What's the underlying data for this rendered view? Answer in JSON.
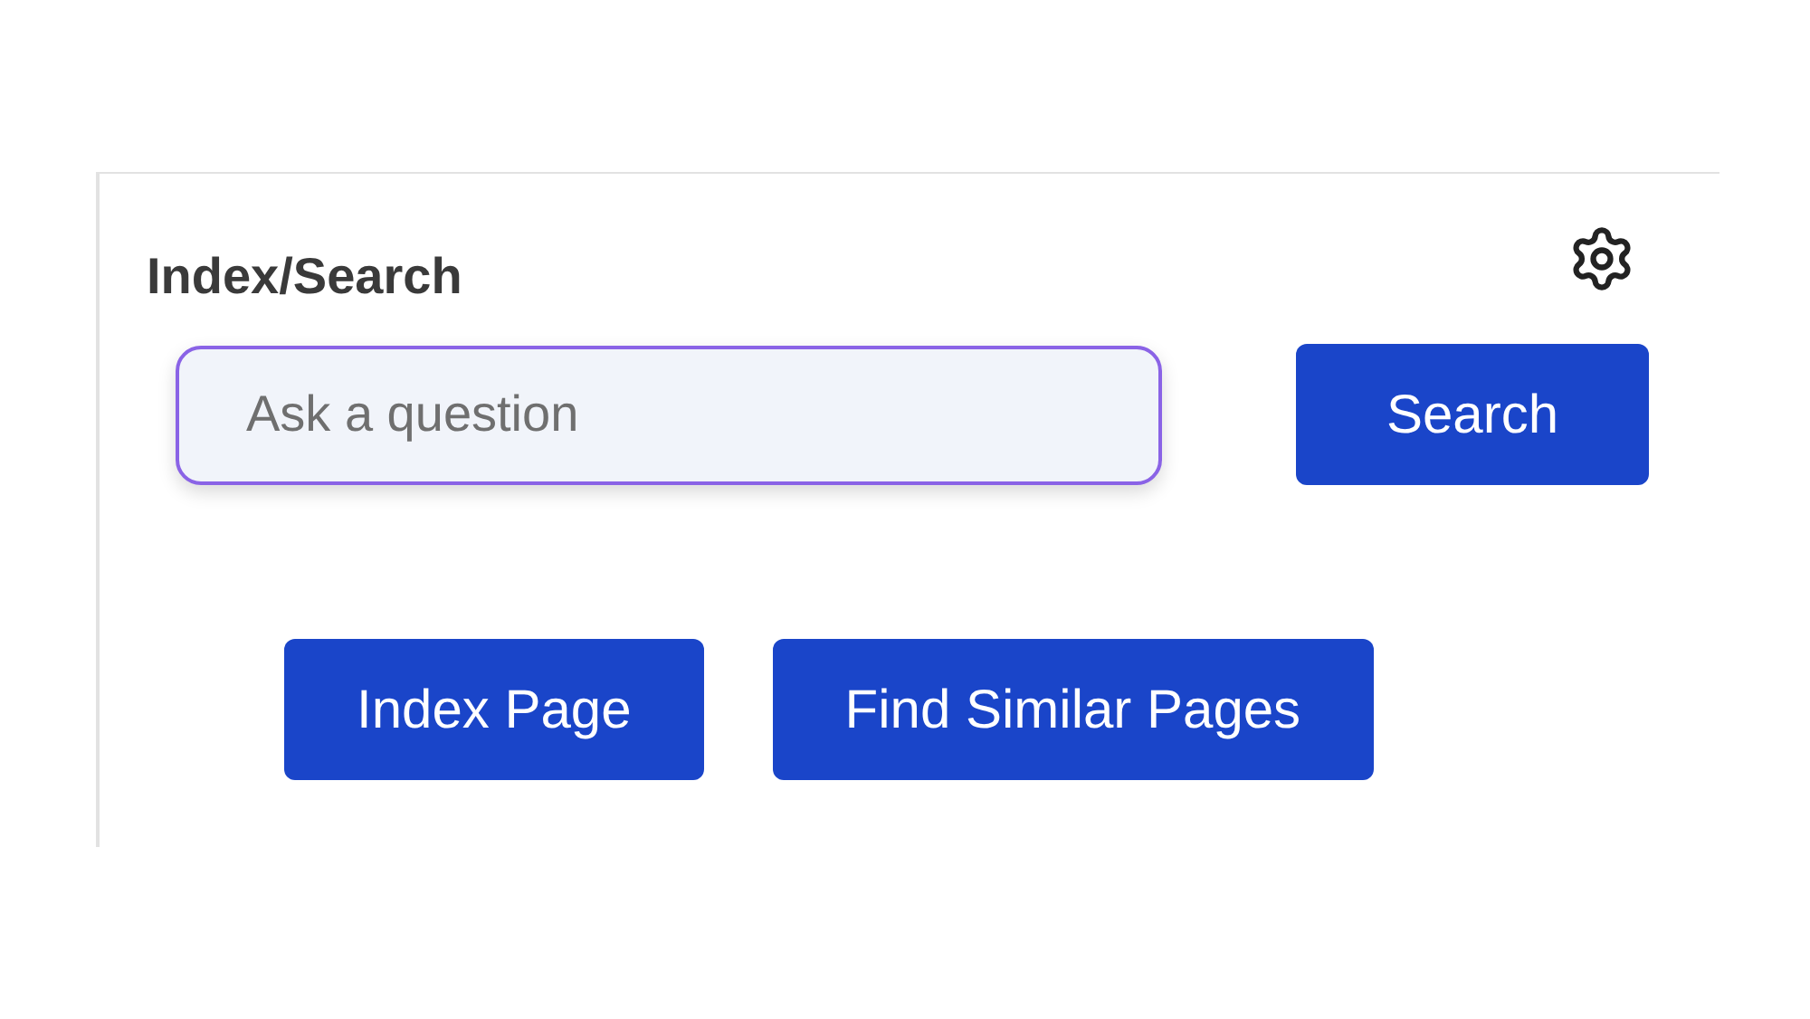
{
  "panel": {
    "title": "Index/Search"
  },
  "search": {
    "placeholder": "Ask a question",
    "button": "Search"
  },
  "actions": [
    "Index Page",
    "Find Similar Pages"
  ]
}
